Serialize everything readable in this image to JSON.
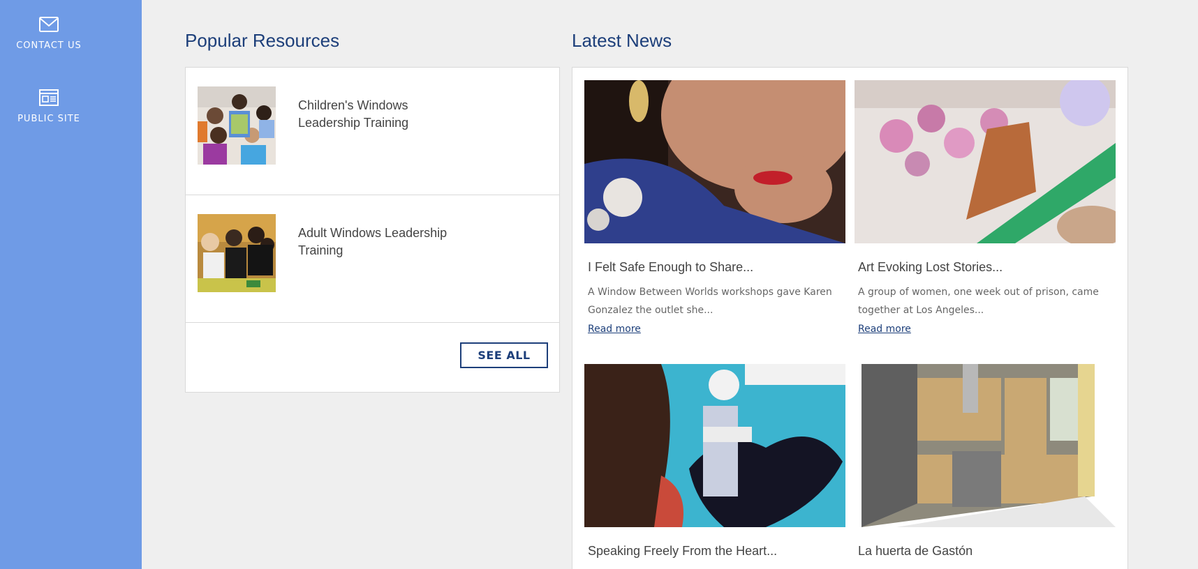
{
  "sidebar": {
    "items": [
      {
        "label": "CONTACT US",
        "icon": "envelope-icon"
      },
      {
        "label": "PUBLIC SITE",
        "icon": "browser-window-icon"
      }
    ]
  },
  "popular_resources": {
    "title": "Popular Resources",
    "items": [
      {
        "title": "Children's Windows Leadership Training",
        "image": "children-holding-art-photo"
      },
      {
        "title": "Adult Windows Leadership Training",
        "image": "adults-at-table-photo"
      }
    ],
    "see_all_label": "SEE ALL"
  },
  "latest_news": {
    "title": "Latest News",
    "items": [
      {
        "title": "I Felt Safe Enough to Share...",
        "excerpt": "A Window Between Worlds workshops gave Karen Gonzalez the outlet she...",
        "link": "Read more",
        "image": "woman-with-button-photo"
      },
      {
        "title": "Art Evoking Lost Stories...",
        "excerpt": "A group of women, one week out of prison, came together at Los Angeles...",
        "link": "Read more",
        "image": "tree-collage-artwork-photo"
      },
      {
        "title": "Speaking Freely From the Heart...",
        "image": "heart-artwork-photo"
      },
      {
        "title": "La huerta de Gastón",
        "image": "kitchen-render-photo"
      }
    ]
  },
  "colors": {
    "sidebar_bg": "#6f9be6",
    "heading": "#1d3f7a",
    "page_bg": "#efefef"
  }
}
